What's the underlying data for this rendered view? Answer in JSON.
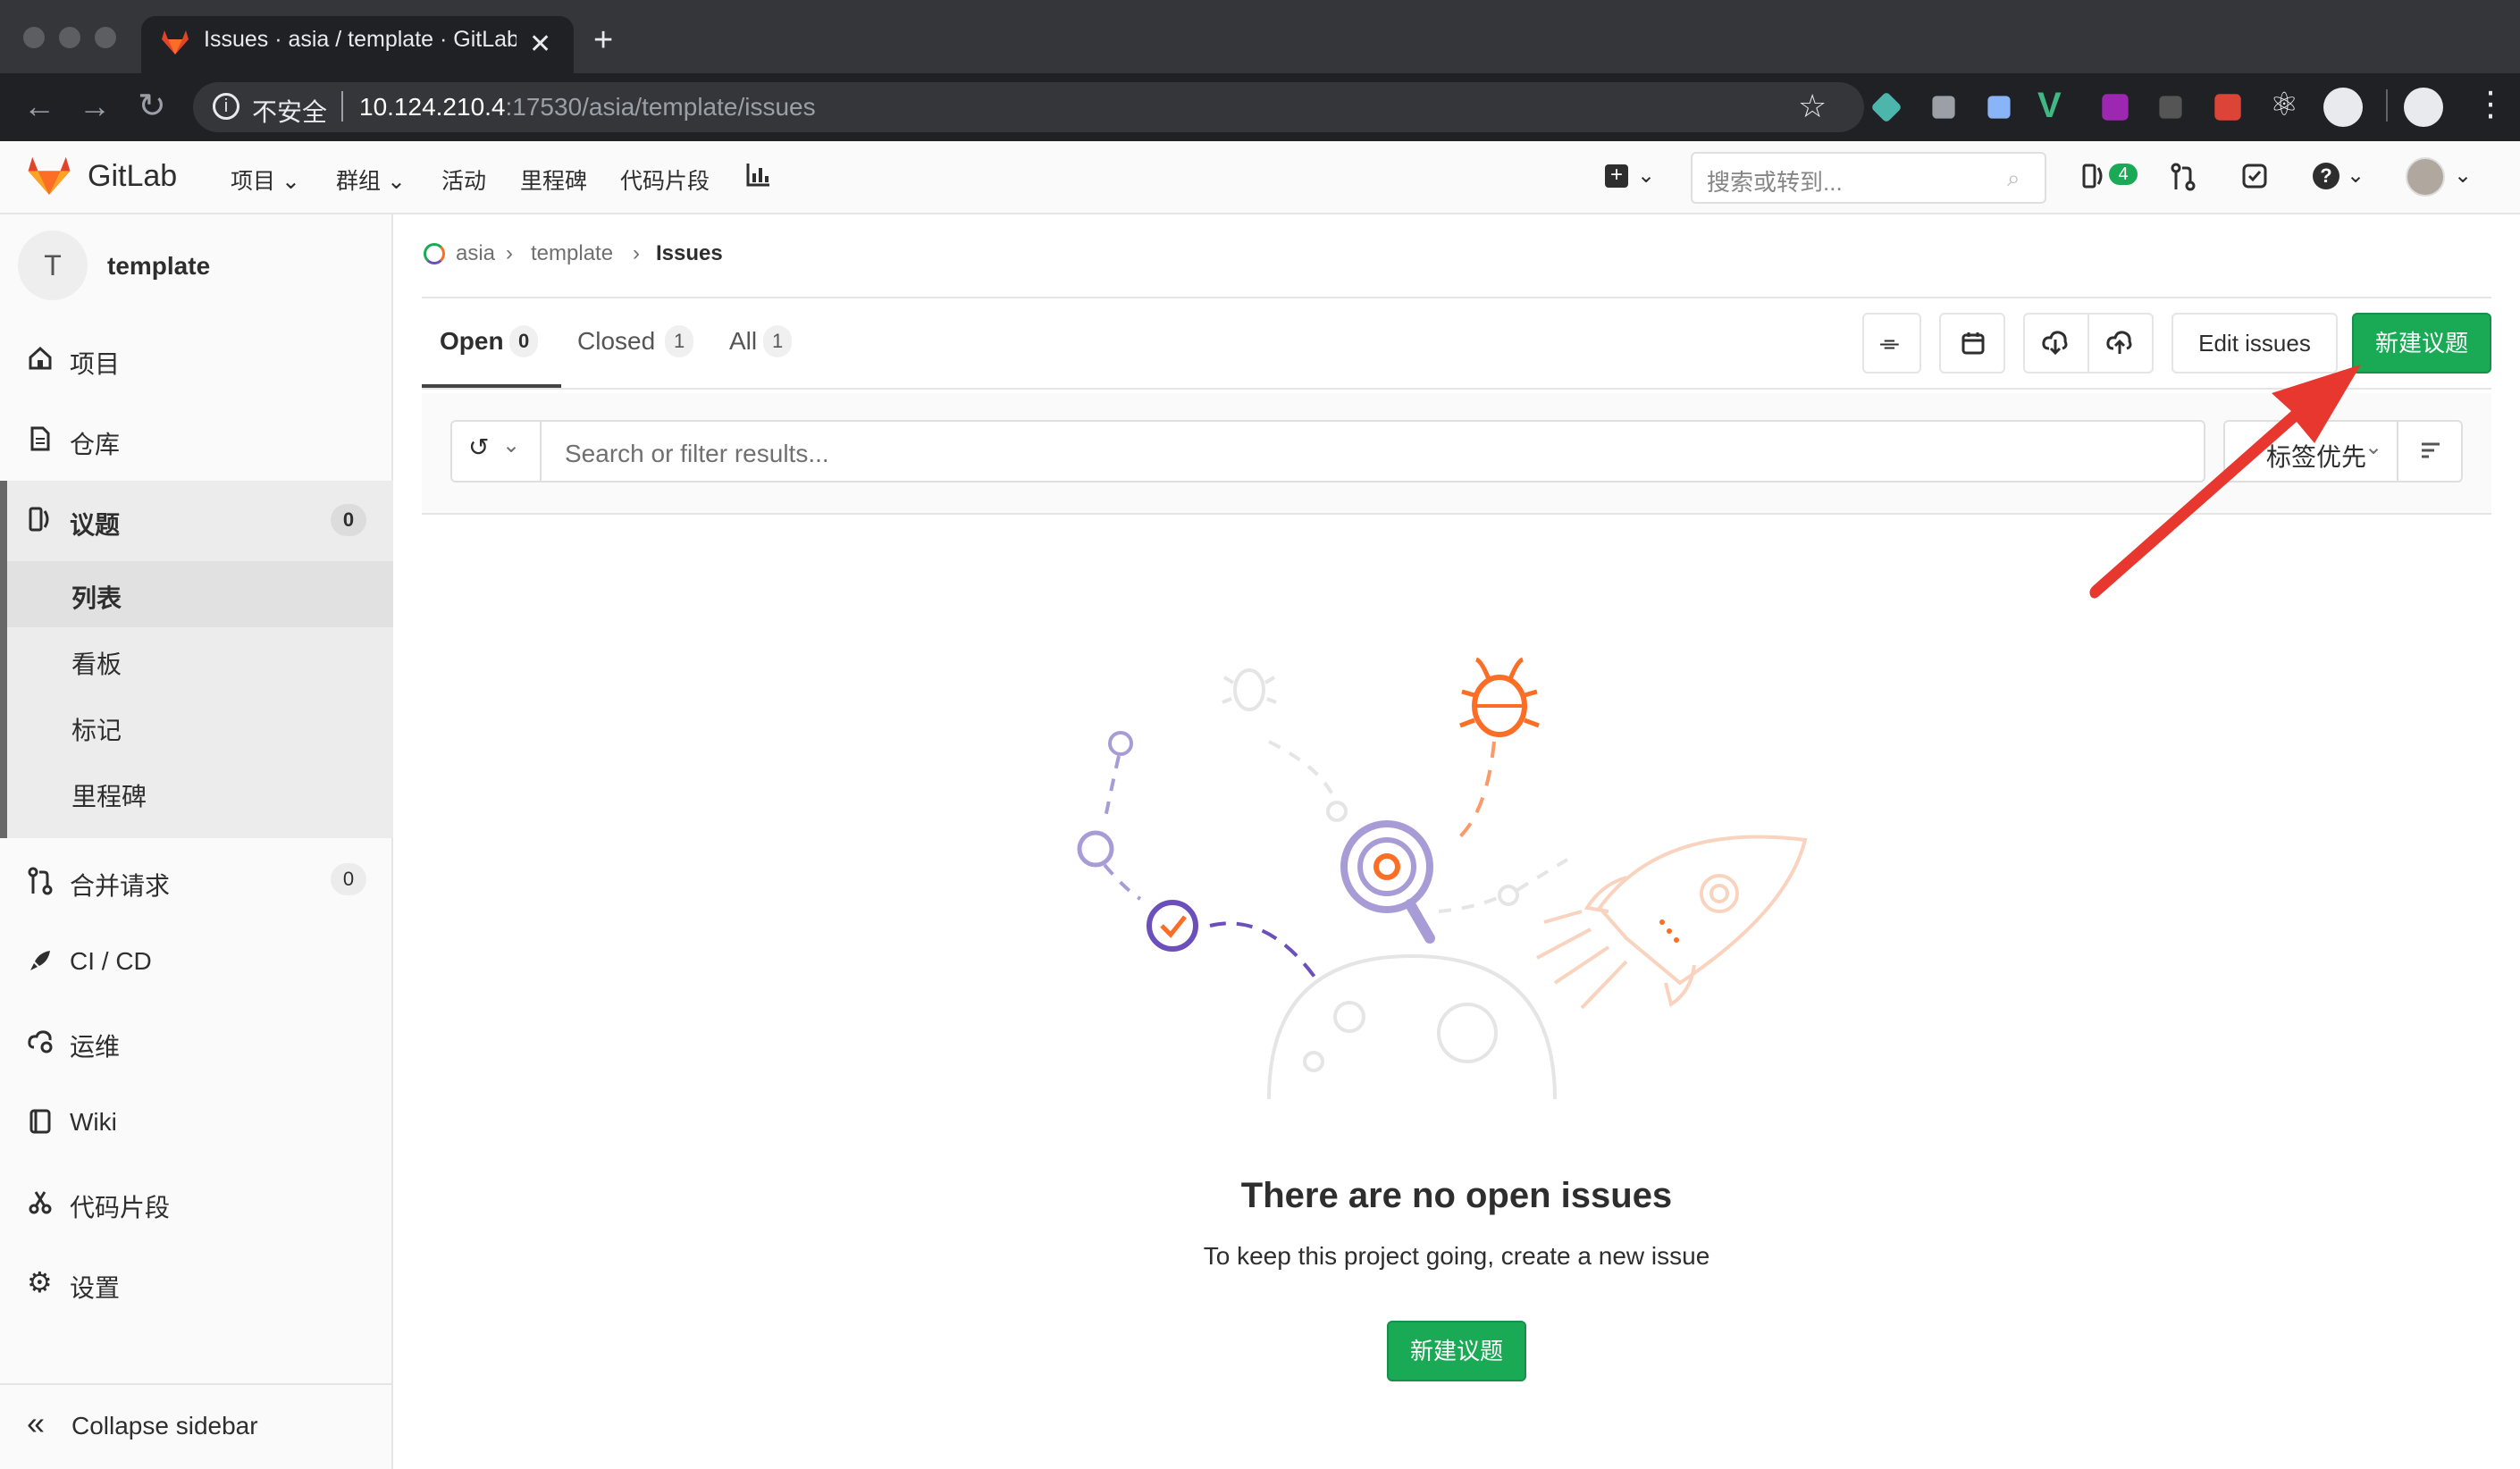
{
  "browser": {
    "tab_title": "Issues · asia / template · GitLab",
    "security_label": "不安全",
    "url_host": "10.124.210.4",
    "url_rest": ":17530/asia/template/issues"
  },
  "nav": {
    "brand": "GitLab",
    "links": [
      "项目",
      "群组",
      "活动",
      "里程碑",
      "代码片段"
    ],
    "search_placeholder": "搜索或转到...",
    "issues_count": "4"
  },
  "sidebar": {
    "project_initial": "T",
    "project_name": "template",
    "items": [
      {
        "label": "项目",
        "icon": "home-icon"
      },
      {
        "label": "仓库",
        "icon": "doc-icon"
      },
      {
        "label": "议题",
        "icon": "issues-icon",
        "count": "0"
      },
      {
        "label": "合并请求",
        "icon": "merge-request-icon",
        "count": "0"
      },
      {
        "label": "CI / CD",
        "icon": "rocket-icon"
      },
      {
        "label": "运维",
        "icon": "cloud-gear-icon"
      },
      {
        "label": "Wiki",
        "icon": "book-icon"
      },
      {
        "label": "代码片段",
        "icon": "scissors-icon"
      },
      {
        "label": "设置",
        "icon": "gear-icon"
      }
    ],
    "issues_sub": [
      "列表",
      "看板",
      "标记",
      "里程碑"
    ],
    "collapse_label": "Collapse sidebar"
  },
  "breadcrumb": [
    "asia",
    "template",
    "Issues"
  ],
  "tabs": [
    {
      "label": "Open",
      "count": "0"
    },
    {
      "label": "Closed",
      "count": "1"
    },
    {
      "label": "All",
      "count": "1"
    }
  ],
  "actions": {
    "edit_issues": "Edit issues",
    "new_issue": "新建议题"
  },
  "filter": {
    "placeholder": "Search or filter results...",
    "sort_label": "标签优先"
  },
  "empty_state": {
    "title": "There are no open issues",
    "subtitle": "To keep this project going, create a new issue",
    "button": "新建议题"
  },
  "colors": {
    "primary_green": "#1aaa55",
    "annotation_red": "#e8372f"
  }
}
